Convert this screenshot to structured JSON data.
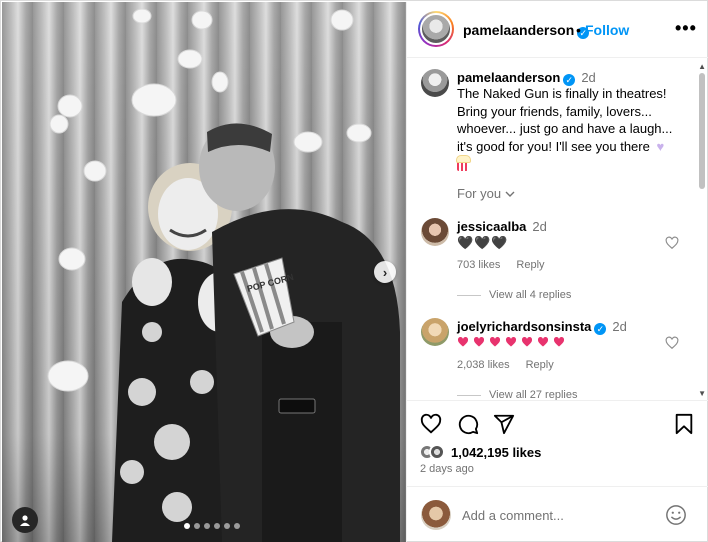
{
  "header": {
    "username": "pamelaanderson",
    "separator": "•",
    "follow_label": "Follow",
    "more_label": "•••"
  },
  "caption": {
    "username": "pamelaanderson",
    "time": "2d",
    "text": "The Naked Gun is finally in theatres! Bring your friends, family, lovers... whoever... just go and have a laugh... it's good for you! I'll see you there"
  },
  "for_you_label": "For you",
  "comments": [
    {
      "username": "jessicaalba",
      "time": "2d",
      "text": "🖤🖤🖤",
      "likes": "703 likes",
      "reply_label": "Reply",
      "view_replies": "View all 4 replies"
    },
    {
      "username": "joelyrichardsonsinsta",
      "time": "2d",
      "heart_count": 7,
      "likes": "2,038 likes",
      "reply_label": "Reply",
      "view_replies": "View all 27 replies"
    }
  ],
  "post": {
    "likes_count": "1,042,195 likes",
    "posted_ago": "2 days ago",
    "comment_placeholder": "Add a comment...",
    "carousel_count": 6,
    "carousel_active": 0
  },
  "popcorn_box_text": "POP CORN",
  "colors": {
    "accent": "#0095f6",
    "muted": "#737373",
    "heart_pink": "#e8336e",
    "popcorn_heart": "#c9b2ec"
  },
  "icons": {
    "like": "heart-icon",
    "comment": "comment-icon",
    "share": "share-icon",
    "save": "bookmark-icon",
    "emoji": "smiley-icon",
    "tag": "user-tag-icon",
    "next": "chevron-right-icon"
  }
}
